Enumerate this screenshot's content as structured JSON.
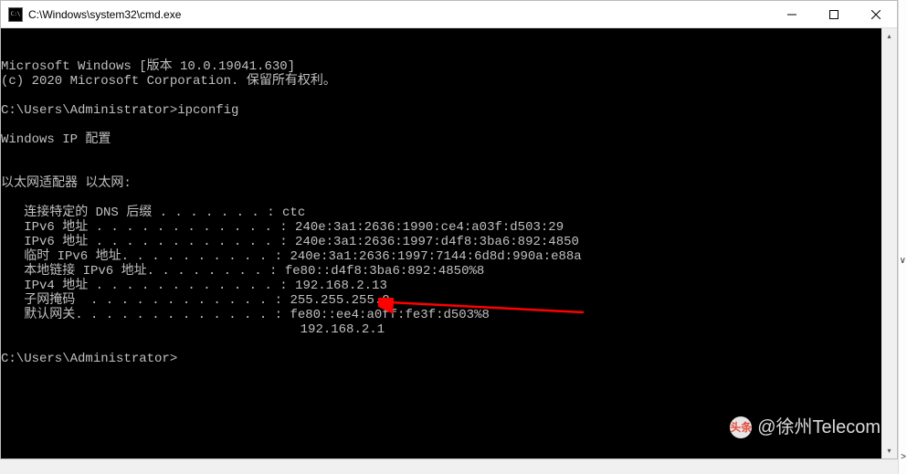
{
  "titlebar": {
    "title": "C:\\Windows\\system32\\cmd.exe"
  },
  "terminal": {
    "lines": [
      "Microsoft Windows [版本 10.0.19041.630]",
      "(c) 2020 Microsoft Corporation. 保留所有权利。",
      "",
      "C:\\Users\\Administrator>ipconfig",
      "",
      "Windows IP 配置",
      "",
      "",
      "以太网适配器 以太网:",
      "",
      "   连接特定的 DNS 后缀 . . . . . . . : ctc",
      "   IPv6 地址 . . . . . . . . . . . . : 240e:3a1:2636:1990:ce4:a03f:d503:29",
      "   IPv6 地址 . . . . . . . . . . . . : 240e:3a1:2636:1997:d4f8:3ba6:892:4850",
      "   临时 IPv6 地址. . . . . . . . . . : 240e:3a1:2636:1997:7144:6d8d:990a:e88a",
      "   本地链接 IPv6 地址. . . . . . . . : fe80::d4f8:3ba6:892:4850%8",
      "   IPv4 地址 . . . . . . . . . . . . : 192.168.2.13",
      "   子网掩码  . . . . . . . . . . . . : 255.255.255.0",
      "   默认网关. . . . . . . . . . . . . : fe80::ee4:a0ff:fe3f:d503%8",
      "                                       192.168.2.1",
      "",
      "C:\\Users\\Administrator>"
    ]
  },
  "watermark": {
    "logo_text": "头条",
    "text": "@徐州Telecom"
  },
  "arrow": {
    "color": "#ff0000"
  }
}
